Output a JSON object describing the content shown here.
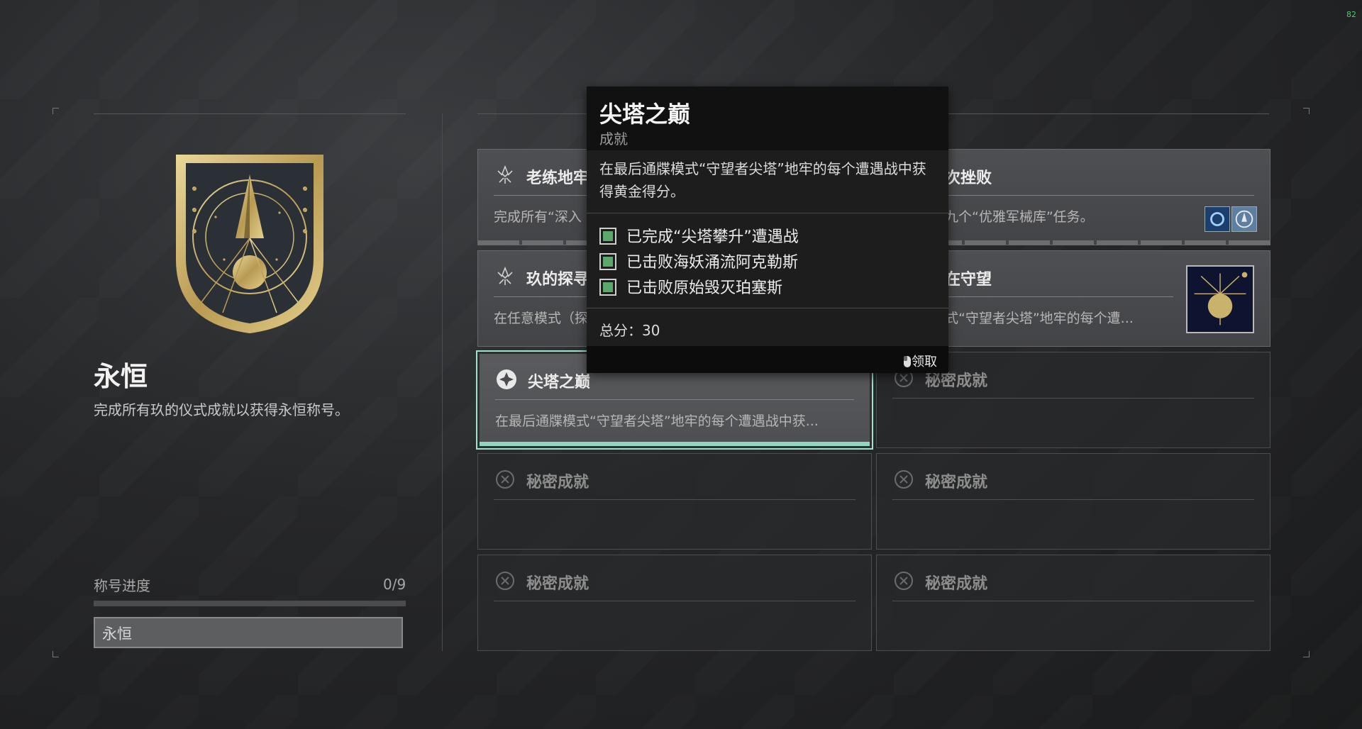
{
  "hud": {
    "fps": "82"
  },
  "seal": {
    "title": "永恒",
    "description": "完成所有玖的仪式成就以获得永恒称号。",
    "progress_label": "称号进度",
    "progress_count": "0/9",
    "progress_fraction": 0.0,
    "title_field_value": "永恒"
  },
  "cards": [
    {
      "title": "老练地牢",
      "desc": "完成所有“深入",
      "icon": "ghost-icon"
    },
    {
      "title": "次挫败",
      "desc": "九个“优雅军械库”任务。",
      "icon": "ghost-icon"
    },
    {
      "title": "玖的探寻",
      "desc": "在任意模式（探",
      "icon": "ghost-icon"
    },
    {
      "title": "在守望",
      "desc": "式“守望者尖塔”地牢的每个遭...",
      "icon": "ghost-icon"
    },
    {
      "title": "尖塔之巅",
      "desc": "在最后通牒模式“守望者尖塔”地牢的每个遭遇战中获...",
      "icon": "diamond-icon"
    },
    {
      "title": "秘密成就",
      "desc": "",
      "icon": "locked-icon"
    },
    {
      "title": "秘密成就",
      "desc": "",
      "icon": "locked-icon"
    },
    {
      "title": "秘密成就",
      "desc": "",
      "icon": "locked-icon"
    },
    {
      "title": "秘密成就",
      "desc": "",
      "icon": "locked-icon"
    },
    {
      "title": "秘密成就",
      "desc": "",
      "icon": "locked-icon"
    }
  ],
  "tooltip": {
    "title": "尖塔之巅",
    "type": "成就",
    "description": "在最后通牒模式“守望者尖塔”地牢的每个遭遇战中获得黄金得分。",
    "objectives": [
      {
        "label": "已完成“尖塔攀升”遭遇战",
        "complete": true
      },
      {
        "label": "已击败海妖涌流阿克勒斯",
        "complete": true
      },
      {
        "label": "已击败原始毁灭珀塞斯",
        "complete": true
      }
    ],
    "score": "总分：30",
    "claim": "领取",
    "claim_icon": "mouse-icon"
  },
  "colors": {
    "accent": "#8fd7c1",
    "gold": "#c9b26b",
    "check": "#5aa96a"
  }
}
